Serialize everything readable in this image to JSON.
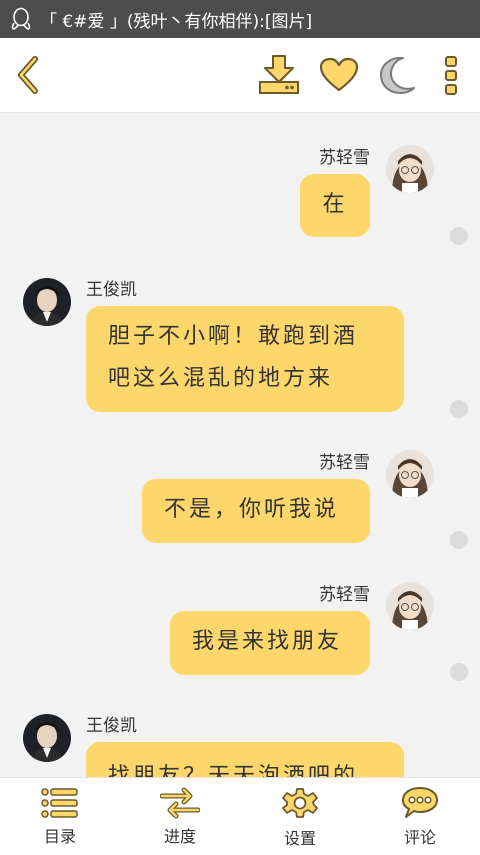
{
  "status_bar": {
    "notification_text": "「 €#爱 」(残叶丶有你相伴):[图片]",
    "app_icon": "qq-penguin-icon"
  },
  "toolbar": {
    "icons": [
      "back-icon",
      "download-icon",
      "heart-icon",
      "moon-icon",
      "more-icon"
    ]
  },
  "messages": [
    {
      "sender": "苏轻雪",
      "side": "right",
      "text": "在"
    },
    {
      "sender": "王俊凯",
      "side": "left",
      "lines": [
        "胆子不小啊！敢跑到酒",
        "吧这么混乱的地方来"
      ]
    },
    {
      "sender": "苏轻雪",
      "side": "right",
      "text": "不是，你听我说"
    },
    {
      "sender": "苏轻雪",
      "side": "right",
      "text": "我是来找朋友"
    },
    {
      "sender": "王俊凯",
      "side": "left",
      "text": "找朋友？天天泡酒吧的"
    }
  ],
  "bottom_nav": [
    {
      "label": "目录",
      "icon": "list-icon"
    },
    {
      "label": "进度",
      "icon": "swap-arrows-icon"
    },
    {
      "label": "设置",
      "icon": "gear-icon"
    },
    {
      "label": "评论",
      "icon": "comment-bubble-icon"
    }
  ],
  "colors": {
    "accent": "#fdd76b",
    "icon_stroke": "#6b5a2a",
    "chat_background": "#f2f2f2",
    "status_bar": "#4d4d4d"
  }
}
